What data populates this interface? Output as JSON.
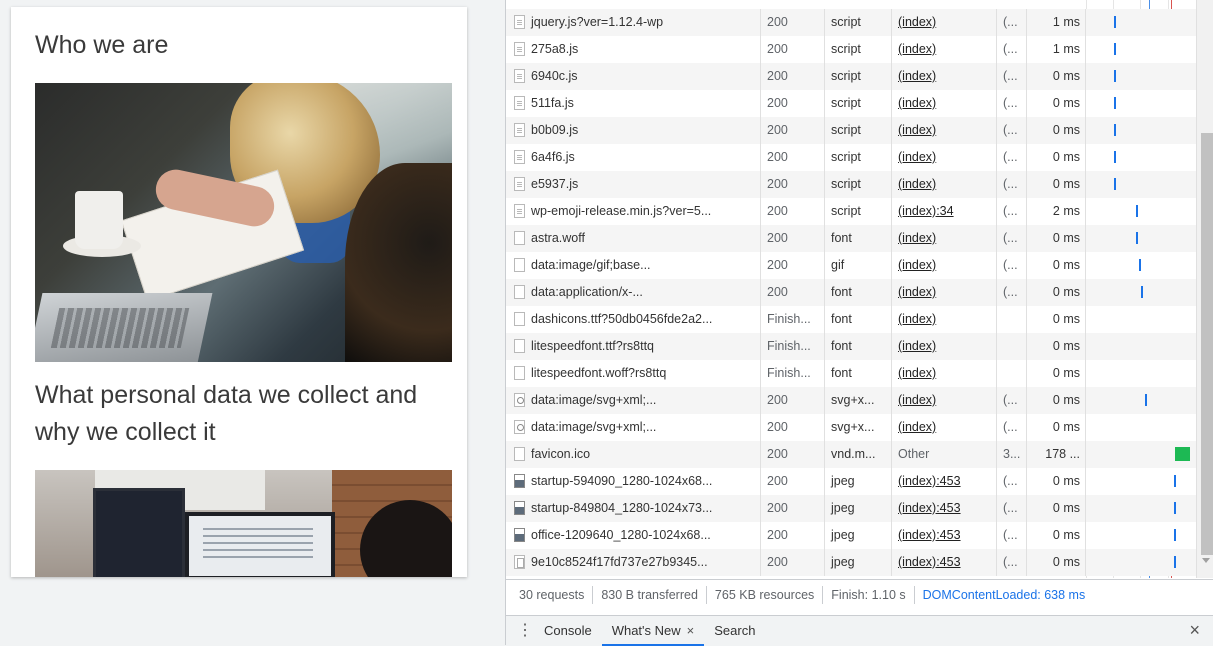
{
  "page": {
    "cut_heading": "...",
    "heading_who": "Who we are",
    "heading_what": "What personal data we collect and why we collect it"
  },
  "network": {
    "rows": [
      {
        "name": "jquery.js?ver=1.12.4-wp",
        "status": "200",
        "type": "script",
        "initiator": "(index)",
        "size": "(...",
        "time": "1 ms",
        "icon": "script-file-icon",
        "bar": 0.25
      },
      {
        "name": "275a8.js",
        "status": "200",
        "type": "script",
        "initiator": "(index)",
        "size": "(...",
        "time": "1 ms",
        "icon": "script-file-icon",
        "bar": 0.25
      },
      {
        "name": "6940c.js",
        "status": "200",
        "type": "script",
        "initiator": "(index)",
        "size": "(...",
        "time": "0 ms",
        "icon": "script-file-icon",
        "bar": 0.25
      },
      {
        "name": "511fa.js",
        "status": "200",
        "type": "script",
        "initiator": "(index)",
        "size": "(...",
        "time": "0 ms",
        "icon": "script-file-icon",
        "bar": 0.25
      },
      {
        "name": "b0b09.js",
        "status": "200",
        "type": "script",
        "initiator": "(index)",
        "size": "(...",
        "time": "0 ms",
        "icon": "script-file-icon",
        "bar": 0.25
      },
      {
        "name": "6a4f6.js",
        "status": "200",
        "type": "script",
        "initiator": "(index)",
        "size": "(...",
        "time": "0 ms",
        "icon": "script-file-icon",
        "bar": 0.25
      },
      {
        "name": "e5937.js",
        "status": "200",
        "type": "script",
        "initiator": "(index)",
        "size": "(...",
        "time": "0 ms",
        "icon": "script-file-icon",
        "bar": 0.25
      },
      {
        "name": "wp-emoji-release.min.js?ver=5...",
        "status": "200",
        "type": "script",
        "initiator": "(index):34",
        "size": "(...",
        "time": "2 ms",
        "icon": "script-file-icon",
        "bar": 0.45
      },
      {
        "name": "astra.woff",
        "status": "200",
        "type": "font",
        "initiator": "(index)",
        "size": "(...",
        "time": "0 ms",
        "icon": "blank-file-icon",
        "bar": 0.45
      },
      {
        "name": "data:image/gif;base...",
        "status": "200",
        "type": "gif",
        "initiator": "(index)",
        "size": "(...",
        "time": "0 ms",
        "icon": "blank-file-icon",
        "bar": 0.48
      },
      {
        "name": "data:application/x-...",
        "status": "200",
        "type": "font",
        "initiator": "(index)",
        "size": "(...",
        "time": "0 ms",
        "icon": "blank-file-icon",
        "bar": 0.5
      },
      {
        "name": "dashicons.ttf?50db0456fde2a2...",
        "status": "Finish...",
        "type": "font",
        "initiator": "(index)",
        "size": "",
        "time": "0 ms",
        "icon": "blank-file-icon",
        "bar": null
      },
      {
        "name": "litespeedfont.ttf?rs8ttq",
        "status": "Finish...",
        "type": "font",
        "initiator": "(index)",
        "size": "",
        "time": "0 ms",
        "icon": "blank-file-icon",
        "bar": null
      },
      {
        "name": "litespeedfont.woff?rs8ttq",
        "status": "Finish...",
        "type": "font",
        "initiator": "(index)",
        "size": "",
        "time": "0 ms",
        "icon": "blank-file-icon",
        "bar": null
      },
      {
        "name": "data:image/svg+xml;...",
        "status": "200",
        "type": "svg+x...",
        "initiator": "(index)",
        "size": "(...",
        "time": "0 ms",
        "icon": "svg-file-icon",
        "bar": 0.54
      },
      {
        "name": "data:image/svg+xml;...",
        "status": "200",
        "type": "svg+x...",
        "initiator": "(index)",
        "size": "(...",
        "time": "0 ms",
        "icon": "svg-file-icon",
        "bar": null
      },
      {
        "name": "favicon.ico",
        "status": "200",
        "type": "vnd.m...",
        "initiator": "Other",
        "size": "3...",
        "time": "178 ...",
        "icon": "blank-file-icon",
        "bar": "green"
      },
      {
        "name": "startup-594090_1280-1024x68...",
        "status": "200",
        "type": "jpeg",
        "initiator": "(index):453",
        "size": "(...",
        "time": "0 ms",
        "icon": "image-file-icon",
        "bar": 0.8
      },
      {
        "name": "startup-849804_1280-1024x73...",
        "status": "200",
        "type": "jpeg",
        "initiator": "(index):453",
        "size": "(...",
        "time": "0 ms",
        "icon": "image-file-icon",
        "bar": 0.8
      },
      {
        "name": "office-1209640_1280-1024x68...",
        "status": "200",
        "type": "jpeg",
        "initiator": "(index):453",
        "size": "(...",
        "time": "0 ms",
        "icon": "image-file-icon",
        "bar": 0.8
      },
      {
        "name": "9e10c8524f17fd737e27b9345...",
        "status": "200",
        "type": "jpeg",
        "initiator": "(index):453",
        "size": "(...",
        "time": "0 ms",
        "icon": "image-blank-file-icon",
        "bar": 0.8
      }
    ]
  },
  "summary": {
    "requests": "30 requests",
    "transferred": "830 B transferred",
    "resources": "765 KB resources",
    "finish": "Finish: 1.10 s",
    "dom_content_loaded": "DOMContentLoaded: 638 ms"
  },
  "drawer": {
    "tabs": [
      {
        "label": "Console",
        "active": false
      },
      {
        "label": "What's New",
        "active": true
      },
      {
        "label": "Search",
        "active": false
      }
    ],
    "tab_close_glyph": "×",
    "close_glyph": "×",
    "menu_glyph": "⋮"
  },
  "colors": {
    "accent": "#1a73e8",
    "dom_line": "#4a8fe7",
    "load_line": "#d9534f",
    "favicon_bar": "#1db954"
  }
}
